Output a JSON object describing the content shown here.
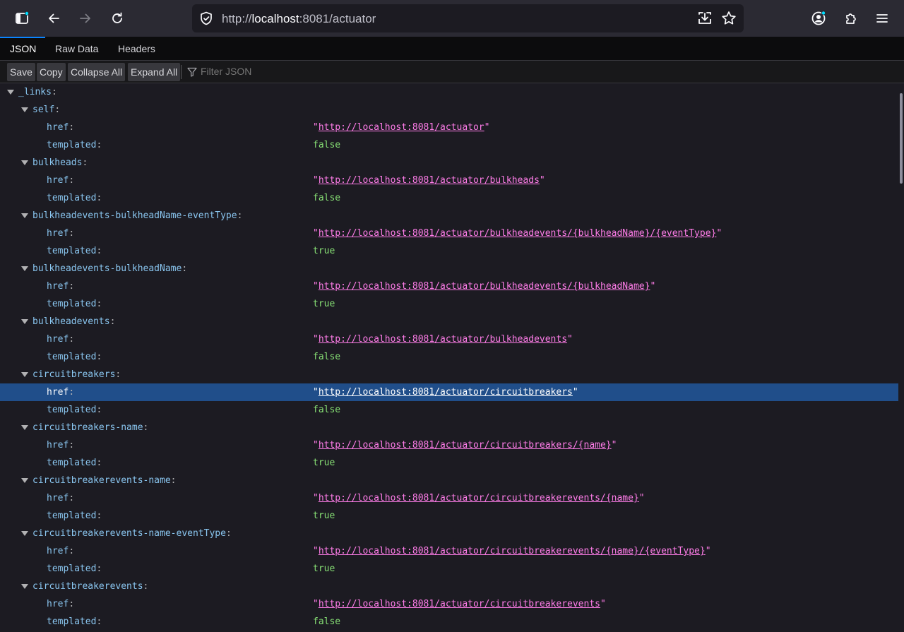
{
  "browser": {
    "url_scheme": "http://",
    "url_host": "localhost",
    "url_rest": ":8081/actuator"
  },
  "viewer": {
    "tabs": [
      {
        "label": "JSON",
        "active": true
      },
      {
        "label": "Raw Data",
        "active": false
      },
      {
        "label": "Headers",
        "active": false
      }
    ],
    "actions": {
      "save": "Save",
      "copy": "Copy",
      "collapse_all": "Collapse All",
      "expand_all": "Expand All"
    },
    "filter_placeholder": "Filter JSON"
  },
  "tree": {
    "root_key": "_links",
    "href_key": "href",
    "templated_key": "templated",
    "selected": "circuitbreakers",
    "entries": [
      {
        "name": "self",
        "href": "http://localhost:8081/actuator",
        "templated": "false"
      },
      {
        "name": "bulkheads",
        "href": "http://localhost:8081/actuator/bulkheads",
        "templated": "false"
      },
      {
        "name": "bulkheadevents-bulkheadName-eventType",
        "href": "http://localhost:8081/actuator/bulkheadevents/{bulkheadName}/{eventType}",
        "templated": "true"
      },
      {
        "name": "bulkheadevents-bulkheadName",
        "href": "http://localhost:8081/actuator/bulkheadevents/{bulkheadName}",
        "templated": "true"
      },
      {
        "name": "bulkheadevents",
        "href": "http://localhost:8081/actuator/bulkheadevents",
        "templated": "false"
      },
      {
        "name": "circuitbreakers",
        "href": "http://localhost:8081/actuator/circuitbreakers",
        "templated": "false"
      },
      {
        "name": "circuitbreakers-name",
        "href": "http://localhost:8081/actuator/circuitbreakers/{name}",
        "templated": "true"
      },
      {
        "name": "circuitbreakerevents-name",
        "href": "http://localhost:8081/actuator/circuitbreakerevents/{name}",
        "templated": "true"
      },
      {
        "name": "circuitbreakerevents-name-eventType",
        "href": "http://localhost:8081/actuator/circuitbreakerevents/{name}/{eventType}",
        "templated": "true"
      },
      {
        "name": "circuitbreakerevents",
        "href": "http://localhost:8081/actuator/circuitbreakerevents",
        "templated": "false"
      }
    ]
  },
  "icons": {
    "sidebar": "sidebar-icon",
    "back": "back-arrow-icon",
    "forward": "forward-arrow-icon",
    "reload": "reload-icon",
    "shield": "tracking-protection-shield-icon",
    "download": "download-icon",
    "bookmark": "bookmark-star-icon",
    "account": "account-icon",
    "extensions": "extensions-puzzle-icon",
    "menu": "hamburger-menu-icon",
    "filter": "filter-funnel-icon"
  },
  "colors": {
    "key": "#8ac6f0",
    "string": "#ff7de9",
    "boolean": "#86de74",
    "selection": "#204e8a",
    "accent": "#0a84ff"
  }
}
